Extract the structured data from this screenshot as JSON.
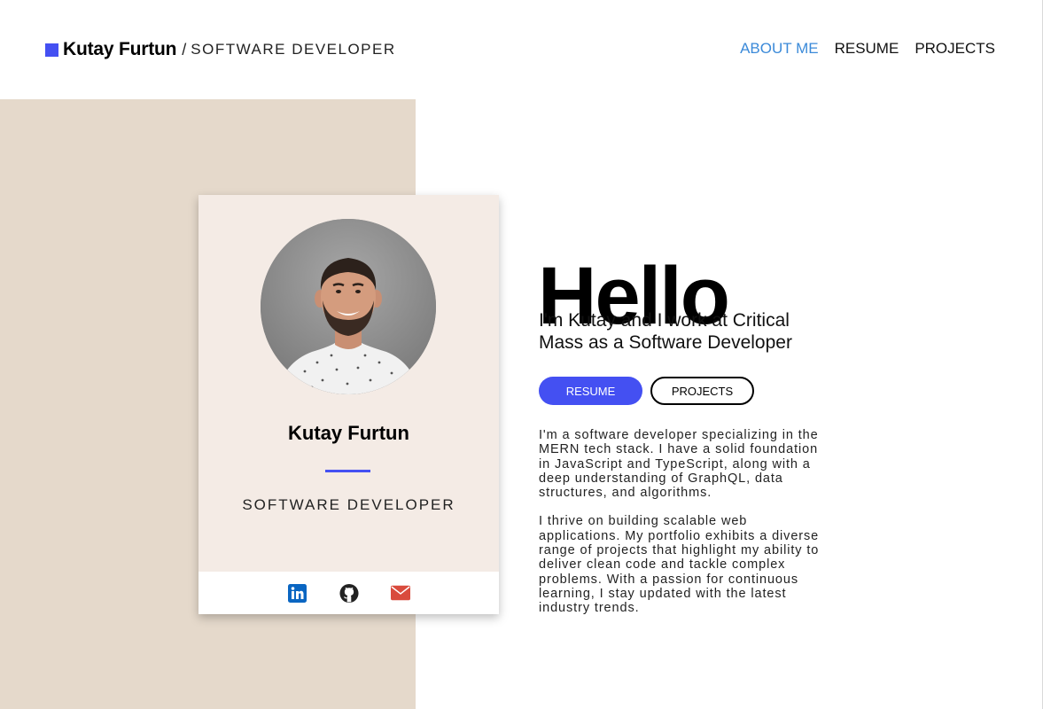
{
  "header": {
    "brand_name": "Kutay Furtun",
    "brand_separator": "/",
    "brand_role": "SOFTWARE DEVELOPER",
    "accent_color": "#4450f2"
  },
  "nav": {
    "items": [
      {
        "label": "ABOUT ME",
        "active": true
      },
      {
        "label": "RESUME",
        "active": false
      },
      {
        "label": "PROJECTS",
        "active": false
      }
    ],
    "active_color": "#3b8ad9"
  },
  "card": {
    "name": "Kutay Furtun",
    "role": "SOFTWARE DEVELOPER",
    "social": [
      {
        "icon": "linkedin-icon",
        "color": "#0a66c2"
      },
      {
        "icon": "github-icon",
        "color": "#222222"
      },
      {
        "icon": "email-icon",
        "color": "#d94b3d"
      }
    ]
  },
  "main": {
    "greeting": "Hello",
    "intro": "I'm Kutay and I work at Critical Mass as a Software Developer",
    "buttons": {
      "resume": "RESUME",
      "projects": "PROJECTS"
    },
    "bio": [
      "I'm a software developer specializing in the MERN tech stack. I have a solid foundation in JavaScript and TypeScript, along with a deep understanding of GraphQL, data structures, and algorithms.",
      "I thrive on building scalable web applications. My portfolio exhibits a diverse range of projects that highlight my ability to deliver clean code and tackle complex problems. With a passion for continuous learning, I stay updated with the latest industry trends."
    ]
  },
  "colors": {
    "left_panel": "#e5d9cb",
    "card_bg": "#f4ebe5"
  }
}
